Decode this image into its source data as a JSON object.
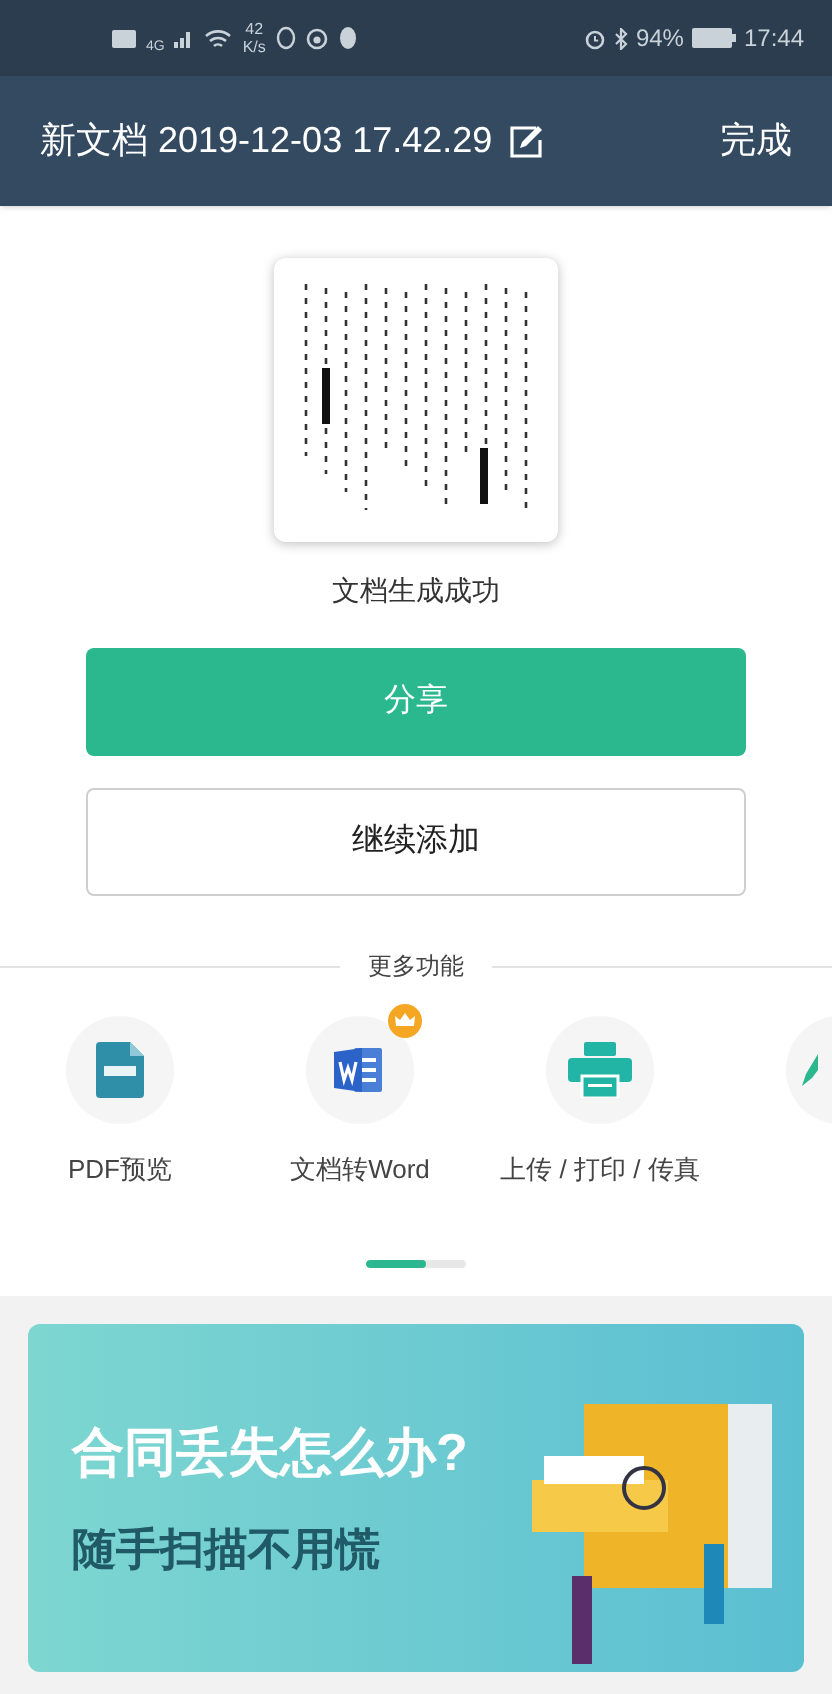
{
  "status_bar": {
    "network": "4G",
    "speed": "42",
    "speed_unit": "K/s",
    "battery": "94%",
    "time": "17:44"
  },
  "header": {
    "title": "新文档 2019-12-03 17.42.29",
    "done": "完成"
  },
  "result": {
    "message": "文档生成成功"
  },
  "buttons": [
    {
      "label": "分享",
      "kind": "primary"
    },
    {
      "label": "继续添加",
      "kind": "outline"
    }
  ],
  "more": {
    "title": "更多功能",
    "features": [
      {
        "label": "PDF预览",
        "kind": "pdf",
        "premium": false
      },
      {
        "label": "文档转Word",
        "kind": "word",
        "premium": true
      },
      {
        "label": "上传 / 打印 / 传真",
        "kind": "printer",
        "premium": false
      },
      {
        "kind": "pen",
        "premium": false
      }
    ],
    "scroll": {
      "level": 0.6
    }
  },
  "banner": {
    "headline": "合同丢失怎么办?",
    "subline": "随手扫描不用慌"
  }
}
